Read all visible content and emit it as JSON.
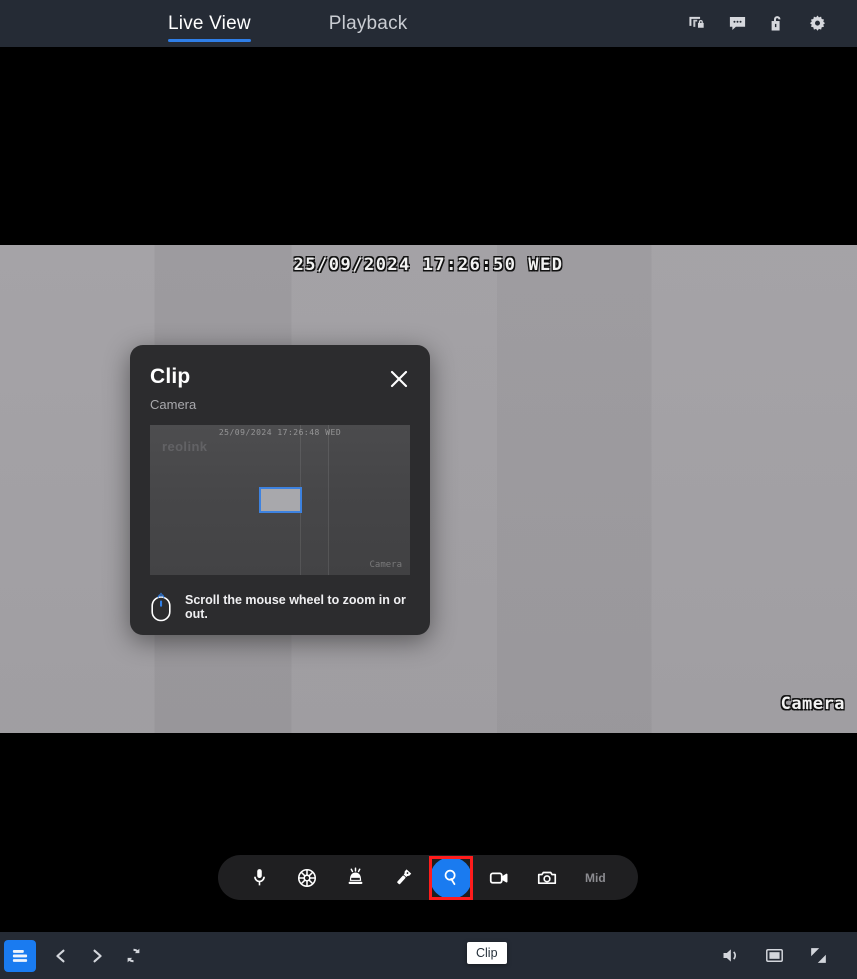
{
  "header": {
    "tabs": [
      {
        "label": "Live View",
        "active": true
      },
      {
        "label": "Playback",
        "active": false
      }
    ],
    "icons": [
      {
        "name": "screen-lock-icon"
      },
      {
        "name": "chat-bubble-icon"
      },
      {
        "name": "unlock-icon"
      },
      {
        "name": "gear-icon"
      }
    ]
  },
  "video": {
    "osd_timestamp": "25/09/2024  17:26:50  WED",
    "osd_camera_label": "Camera"
  },
  "dialog": {
    "title": "Clip",
    "subtitle": "Camera",
    "close_label": "close-icon",
    "hint": "Scroll the mouse wheel to zoom in or out.",
    "thumbnail": {
      "timestamp": "25/09/2024  17:26:48  WED",
      "brand": "reolink",
      "camera_label": "Camera"
    }
  },
  "toolbar": {
    "items": [
      {
        "name": "microphone-icon",
        "selected": false
      },
      {
        "name": "siren-icon",
        "selected": false
      },
      {
        "name": "alarm-light-icon",
        "selected": false
      },
      {
        "name": "flashlight-icon",
        "selected": false
      },
      {
        "name": "zoom-clip-icon",
        "selected": true
      },
      {
        "name": "video-record-icon",
        "selected": false
      },
      {
        "name": "photo-snapshot-icon",
        "selected": false
      }
    ],
    "quality_label": "Mid",
    "tooltip": "Clip"
  },
  "statusbar": {
    "menu_icon": "list-menu-icon",
    "left_icons": [
      {
        "name": "previous-icon"
      },
      {
        "name": "next-icon"
      },
      {
        "name": "refresh-icon"
      }
    ],
    "right_icons": [
      {
        "name": "volume-icon"
      },
      {
        "name": "pip-icon"
      },
      {
        "name": "fullscreen-icon"
      }
    ]
  },
  "colors": {
    "accent": "#1a7bf0",
    "tab_underline": "#2f7fe8",
    "highlight_border": "#ff1c1c",
    "chrome": "#252b35",
    "dialog_bg": "#2c2c2e"
  }
}
